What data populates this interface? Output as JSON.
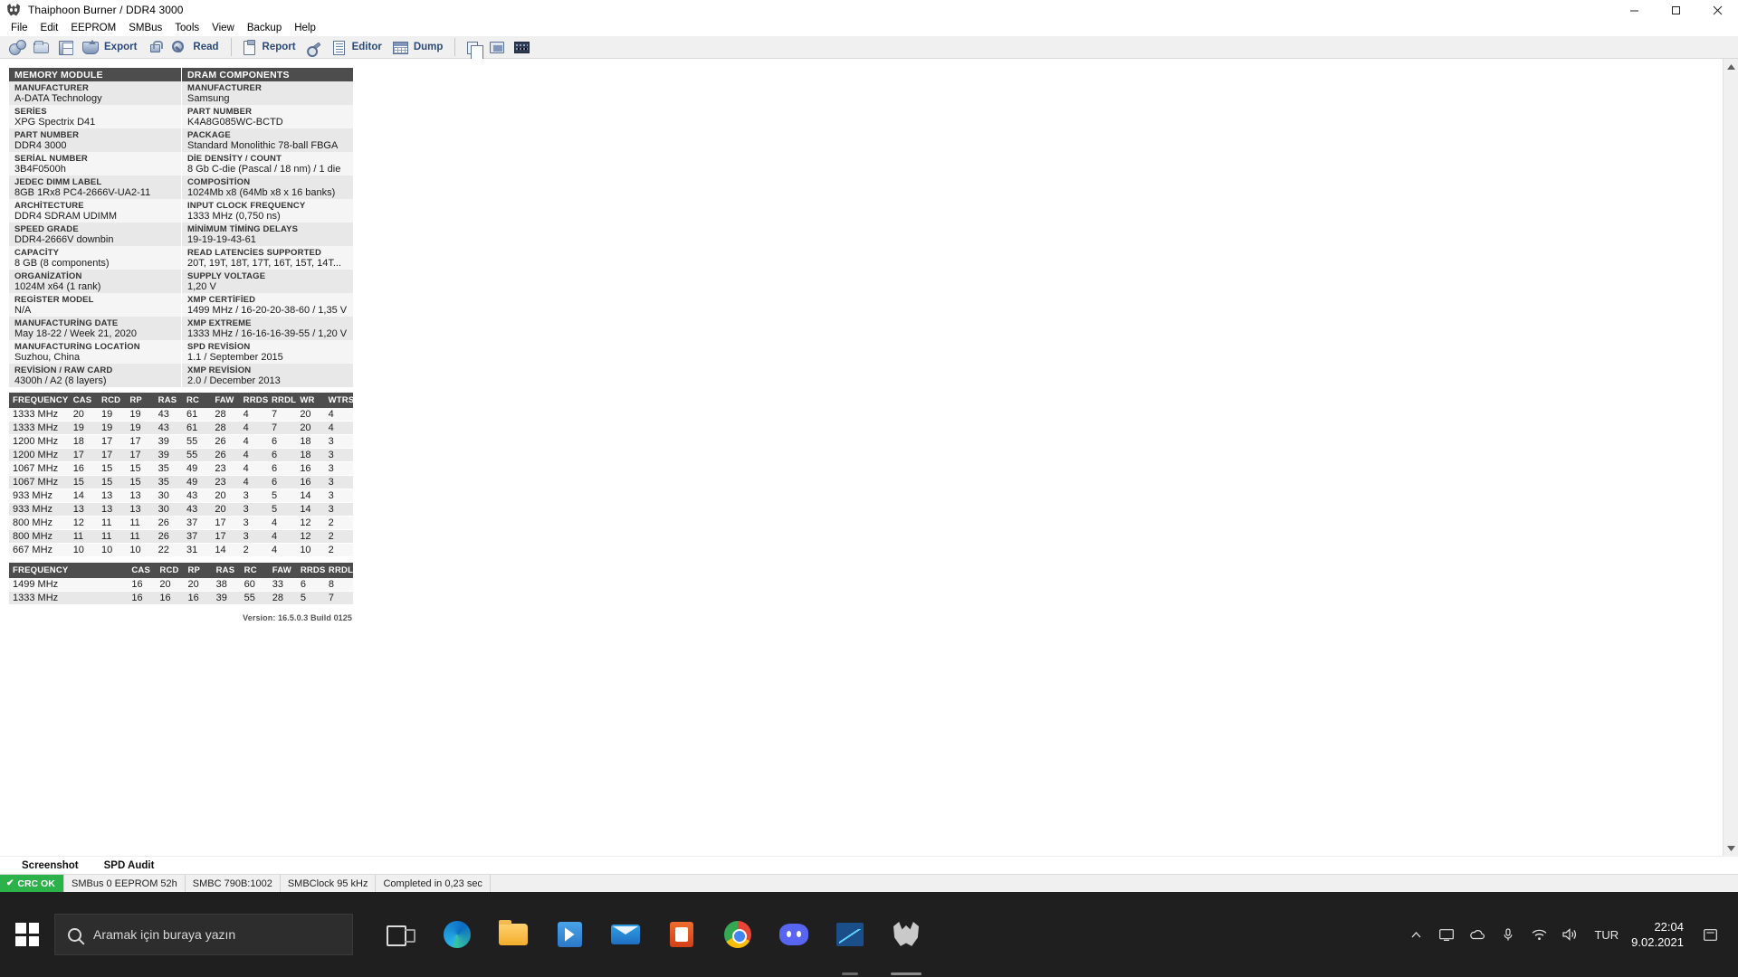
{
  "window": {
    "title": "Thaiphoon Burner / DDR4 3000",
    "icon": "bat-logo-icon",
    "controls": {
      "minimize": "minimize-icon",
      "maximize": "maximize-icon",
      "close": "close-icon"
    }
  },
  "menubar": {
    "items": [
      "File",
      "Edit",
      "EEPROM",
      "SMBus",
      "Tools",
      "View",
      "Backup",
      "Help"
    ]
  },
  "toolbar": {
    "buttons": [
      {
        "name": "settings-gears-button",
        "icon": "gears-icon",
        "label": ""
      },
      {
        "name": "open-button",
        "icon": "folder-icon",
        "label": ""
      },
      {
        "name": "save-button",
        "icon": "floppy-disk-icon",
        "label": ""
      },
      {
        "name": "export-button",
        "icon": "export-icon",
        "label": "Export"
      },
      {
        "name": "lock-button",
        "icon": "lock-icon",
        "label": ""
      },
      {
        "name": "read-button",
        "icon": "magnifier-icon",
        "label": "Read"
      },
      {
        "name": "report-button",
        "icon": "clipboard-icon",
        "label": "Report"
      },
      {
        "name": "tools-button",
        "icon": "wrench-icon",
        "label": ""
      },
      {
        "name": "editor-button",
        "icon": "document-lines-icon",
        "label": "Editor"
      },
      {
        "name": "dump-button",
        "icon": "grid-table-icon",
        "label": "Dump"
      },
      {
        "name": "copy-button",
        "icon": "copy-icon",
        "label": ""
      },
      {
        "name": "chip-button",
        "icon": "chip-icon",
        "label": ""
      },
      {
        "name": "hex-button",
        "icon": "hex-view-icon",
        "label": ""
      }
    ]
  },
  "report": {
    "memory_module": {
      "header": "MEMORY MODULE",
      "rows": [
        {
          "key": "MANUFACTURER",
          "value": "A-DATA Technology"
        },
        {
          "key": "SERİES",
          "value": "XPG Spectrix D41"
        },
        {
          "key": "PART NUMBER",
          "value": "DDR4 3000"
        },
        {
          "key": "SERİAL NUMBER",
          "value": "3B4F0500h"
        },
        {
          "key": "JEDEC DIMM LABEL",
          "value": "8GB 1Rx8 PC4-2666V-UA2-11"
        },
        {
          "key": "ARCHİTECTURE",
          "value": "DDR4 SDRAM UDIMM"
        },
        {
          "key": "SPEED GRADE",
          "value": "DDR4-2666V downbin"
        },
        {
          "key": "CAPACİTY",
          "value": "8 GB (8 components)"
        },
        {
          "key": "ORGANİZATİON",
          "value": "1024M x64 (1 rank)"
        },
        {
          "key": "REGİSTER MODEL",
          "value": "N/A"
        },
        {
          "key": "MANUFACTURİNG DATE",
          "value": "May 18-22 / Week 21, 2020"
        },
        {
          "key": "MANUFACTURİNG LOCATİON",
          "value": "Suzhou, China"
        },
        {
          "key": "REVİSİON / RAW CARD",
          "value": "4300h / A2 (8 layers)"
        }
      ]
    },
    "dram_components": {
      "header": "DRAM COMPONENTS",
      "rows": [
        {
          "key": "MANUFACTURER",
          "value": "Samsung"
        },
        {
          "key": "PART NUMBER",
          "value": "K4A8G085WC-BCTD"
        },
        {
          "key": "PACKAGE",
          "value": "Standard Monolithic 78-ball FBGA"
        },
        {
          "key": "DİE DENSİTY / COUNT",
          "value": "8 Gb C-die (Pascal / 18 nm) / 1 die"
        },
        {
          "key": "COMPOSİTİON",
          "value": "1024Mb x8 (64Mb x8 x 16 banks)"
        },
        {
          "key": "INPUT CLOCK FREQUENCY",
          "value": "1333 MHz (0,750 ns)"
        },
        {
          "key": "MİNİMUM TİMİNG DELAYS",
          "value": "19-19-19-43-61"
        },
        {
          "key": "READ LATENCİES SUPPORTED",
          "value": "20T, 19T, 18T, 17T, 16T, 15T, 14T..."
        },
        {
          "key": "SUPPLY VOLTAGE",
          "value": "1,20 V"
        },
        {
          "key": "XMP CERTİFİED",
          "value": "1499 MHz / 16-20-20-38-60 / 1,35 V"
        },
        {
          "key": "XMP EXTREME",
          "value": "1333 MHz / 16-16-16-39-55 / 1,20 V"
        },
        {
          "key": "SPD REVİSİON",
          "value": "1.1 / September 2015"
        },
        {
          "key": "XMP REVİSİON",
          "value": "2.0 / December 2013"
        }
      ]
    },
    "jedec_timing_table": {
      "columns": [
        "FREQUENCY",
        "CAS",
        "RCD",
        "RP",
        "RAS",
        "RC",
        "FAW",
        "RRDS",
        "RRDL",
        "WR",
        "WTRS"
      ],
      "rows": [
        [
          "1333 MHz",
          "20",
          "19",
          "19",
          "43",
          "61",
          "28",
          "4",
          "7",
          "20",
          "4"
        ],
        [
          "1333 MHz",
          "19",
          "19",
          "19",
          "43",
          "61",
          "28",
          "4",
          "7",
          "20",
          "4"
        ],
        [
          "1200 MHz",
          "18",
          "17",
          "17",
          "39",
          "55",
          "26",
          "4",
          "6",
          "18",
          "3"
        ],
        [
          "1200 MHz",
          "17",
          "17",
          "17",
          "39",
          "55",
          "26",
          "4",
          "6",
          "18",
          "3"
        ],
        [
          "1067 MHz",
          "16",
          "15",
          "15",
          "35",
          "49",
          "23",
          "4",
          "6",
          "16",
          "3"
        ],
        [
          "1067 MHz",
          "15",
          "15",
          "15",
          "35",
          "49",
          "23",
          "4",
          "6",
          "16",
          "3"
        ],
        [
          "933 MHz",
          "14",
          "13",
          "13",
          "30",
          "43",
          "20",
          "3",
          "5",
          "14",
          "3"
        ],
        [
          "933 MHz",
          "13",
          "13",
          "13",
          "30",
          "43",
          "20",
          "3",
          "5",
          "14",
          "3"
        ],
        [
          "800 MHz",
          "12",
          "11",
          "11",
          "26",
          "37",
          "17",
          "3",
          "4",
          "12",
          "2"
        ],
        [
          "800 MHz",
          "11",
          "11",
          "11",
          "26",
          "37",
          "17",
          "3",
          "4",
          "12",
          "2"
        ],
        [
          "667 MHz",
          "10",
          "10",
          "10",
          "22",
          "31",
          "14",
          "2",
          "4",
          "10",
          "2"
        ]
      ]
    },
    "xmp_timing_table": {
      "columns": [
        "FREQUENCY",
        "CAS",
        "RCD",
        "RP",
        "RAS",
        "RC",
        "FAW",
        "RRDS",
        "RRDL"
      ],
      "rows": [
        [
          "1499 MHz",
          "16",
          "20",
          "20",
          "38",
          "60",
          "33",
          "6",
          "8"
        ],
        [
          "1333 MHz",
          "16",
          "16",
          "16",
          "39",
          "55",
          "28",
          "5",
          "7"
        ]
      ]
    },
    "version": "Version: 16.5.0.3 Build 0125"
  },
  "scrollbar": {
    "up": "scroll-up-arrow-icon",
    "down": "scroll-down-arrow-icon"
  },
  "tabs": [
    {
      "label": "Screenshot",
      "active": true
    },
    {
      "label": "SPD Audit",
      "active": false
    }
  ],
  "statusbar": {
    "crc": {
      "label": "CRC OK",
      "check": "✔",
      "color": "#2bb34a"
    },
    "cells": [
      "SMBus 0 EEPROM 52h",
      "SMBC 790B:1002",
      "SMBClock 95 kHz",
      "Completed in 0,23 sec"
    ]
  },
  "taskbar": {
    "start": "windows-start-icon",
    "search_placeholder": "Aramak için buraya yazın",
    "search_icon": "search-icon",
    "apps": [
      {
        "name": "task-view-icon",
        "label": "Task View"
      },
      {
        "name": "microsoft-edge-icon",
        "label": "Microsoft Edge"
      },
      {
        "name": "file-explorer-icon",
        "label": "File Explorer"
      },
      {
        "name": "microsoft-store-icon",
        "label": "Microsoft Store"
      },
      {
        "name": "mail-icon",
        "label": "Mail"
      },
      {
        "name": "office-icon",
        "label": "Office"
      },
      {
        "name": "google-chrome-icon",
        "label": "Google Chrome"
      },
      {
        "name": "discord-icon",
        "label": "Discord"
      },
      {
        "name": "performance-monitor-icon",
        "label": "Performance"
      },
      {
        "name": "thaiphoon-burner-icon",
        "label": "Thaiphoon Burner"
      }
    ],
    "tray": {
      "overflow": "chevron-up-icon",
      "icons": [
        "display-icon",
        "onedrive-icon",
        "microphone-icon",
        "wifi-icon",
        "speaker-icon"
      ],
      "language": "TUR",
      "time": "22:04",
      "date": "9.02.2021",
      "action_center": "notifications-icon"
    }
  }
}
